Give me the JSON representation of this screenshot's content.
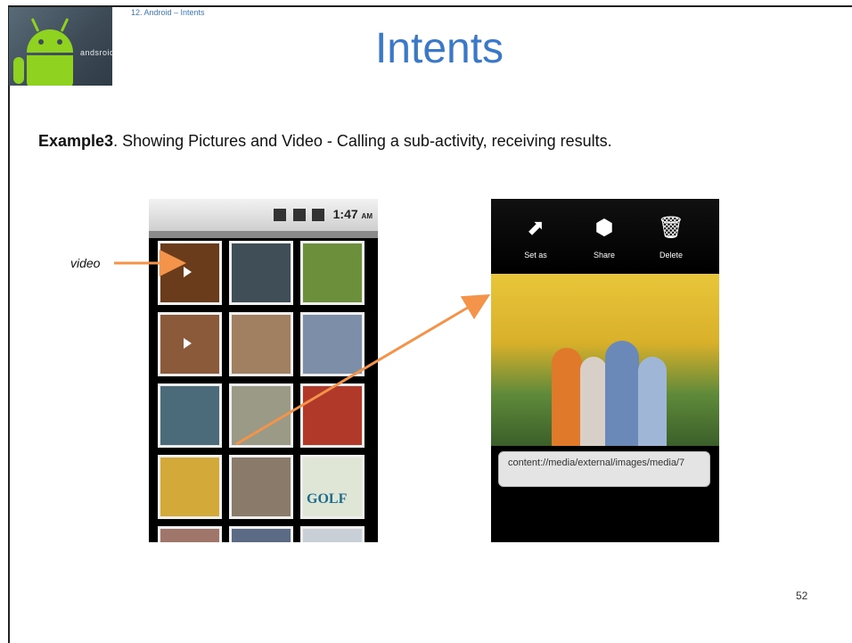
{
  "header": {
    "breadcrumb": "12. Android – Intents",
    "title": "Intents",
    "logo_text": "andsroid"
  },
  "body": {
    "example_bold": "Example3",
    "example_text": ".  Showing Pictures and Video - Calling a sub-activity, receiving results.",
    "video_label": "video"
  },
  "phone_left": {
    "status_time": "1:47",
    "status_ampm": "AM",
    "thumbnails": [
      {
        "kind": "video",
        "color": "#6a3c1c"
      },
      {
        "kind": "photo",
        "color": "#3f4e57"
      },
      {
        "kind": "photo",
        "color": "#6c8f3b"
      },
      {
        "kind": "video",
        "color": "#8b5a3a"
      },
      {
        "kind": "photo",
        "color": "#a08060"
      },
      {
        "kind": "photo",
        "color": "#7d8fa8"
      },
      {
        "kind": "photo",
        "color": "#4c6b7a"
      },
      {
        "kind": "photo",
        "color": "#9a9a86"
      },
      {
        "kind": "photo",
        "color": "#b0392a"
      },
      {
        "kind": "photo",
        "color": "#d3a93a"
      },
      {
        "kind": "photo",
        "color": "#8a7a6a"
      },
      {
        "kind": "photo",
        "color": "#dfe6d6"
      },
      {
        "kind": "photo",
        "color": "#a0756a"
      },
      {
        "kind": "photo",
        "color": "#5b6b86"
      },
      {
        "kind": "photo",
        "color": "#c8cfd6"
      }
    ],
    "golf_text": "GOLF"
  },
  "phone_right": {
    "actions": [
      {
        "label": "Set as",
        "icon": "set-as-icon",
        "glyph": "⬈"
      },
      {
        "label": "Share",
        "icon": "share-icon",
        "glyph": "⬢"
      },
      {
        "label": "Delete",
        "icon": "trash-icon",
        "glyph": "🗑"
      }
    ],
    "uri": "content://media/external/images/media/7"
  },
  "footer": {
    "page_number": "52"
  },
  "colors": {
    "accent": "#3a78c8",
    "arrow": "#f4934a"
  }
}
